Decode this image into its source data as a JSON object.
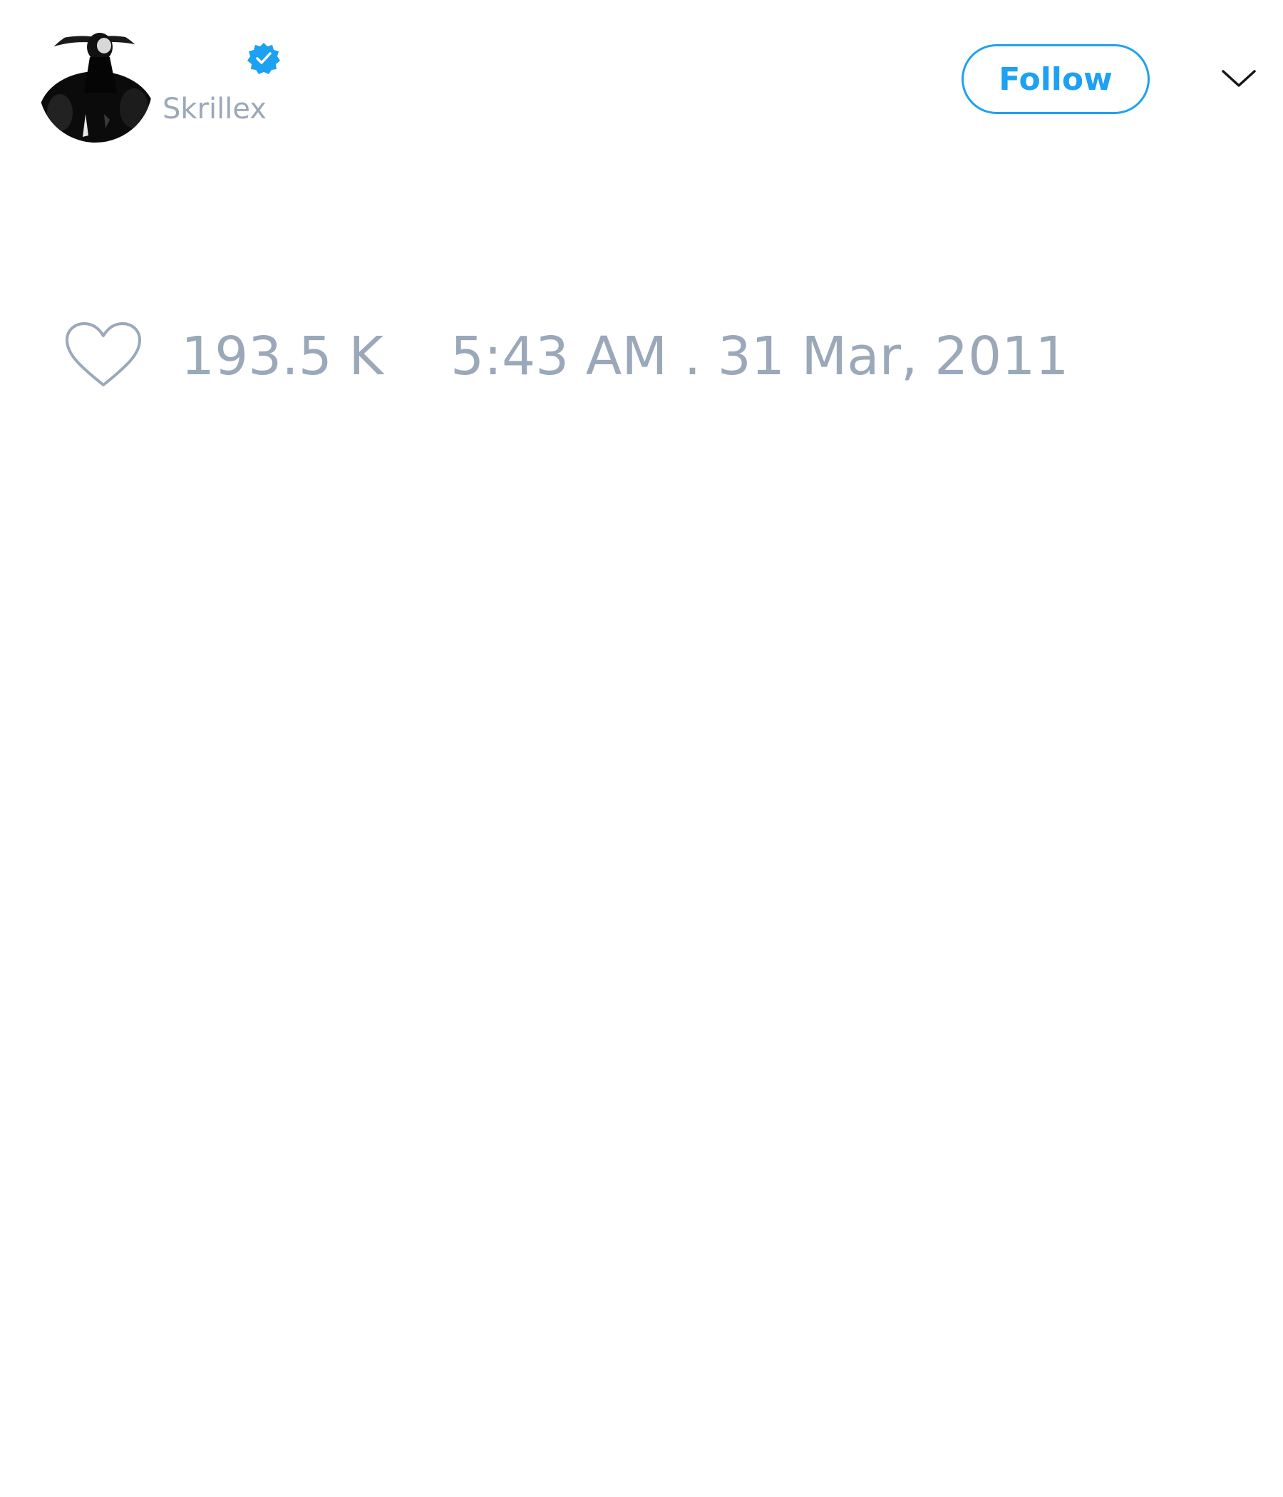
{
  "tweet": {
    "author": {
      "display_name": "",
      "handle": "Skrillex",
      "verified": true,
      "avatar_icon": "profile-photo"
    },
    "follow_label": "Follow",
    "menu_icon": "chevron-down-icon",
    "stats": {
      "like_icon": "heart-outline-icon",
      "likes": "193.5 K",
      "timestamp": "5:43 AM . 31 Mar, 2011"
    }
  },
  "colors": {
    "accent": "#1da1f2",
    "muted_text": "#9aa8ba",
    "background": "#ffffff"
  }
}
